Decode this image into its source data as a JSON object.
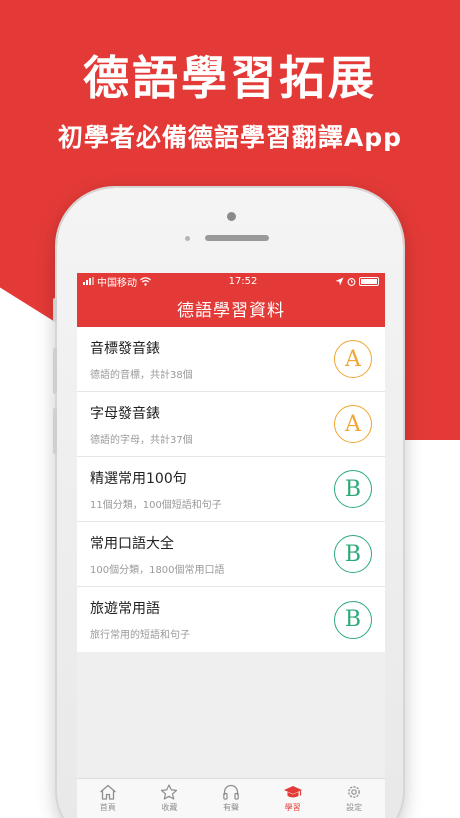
{
  "promo": {
    "title": "德語學習拓展",
    "subtitle": "初學者必備德語學習翻譯App"
  },
  "status_bar": {
    "carrier": "中国移动",
    "time": "17:52"
  },
  "nav": {
    "title": "德語學習資料"
  },
  "list": [
    {
      "title": "音標發音錶",
      "subtitle": "德語的音標，共計38個",
      "level": "A"
    },
    {
      "title": "字母發音錶",
      "subtitle": "德語的字母，共計37個",
      "level": "A"
    },
    {
      "title": "精選常用100句",
      "subtitle": "11個分類，100個短語和句子",
      "level": "B"
    },
    {
      "title": "常用口語大全",
      "subtitle": "100個分類，1800個常用口語",
      "level": "B"
    },
    {
      "title": "旅遊常用語",
      "subtitle": "旅行常用的短語和句子",
      "level": "B"
    }
  ],
  "tabs": [
    {
      "label": "首頁",
      "icon": "home-icon",
      "active": false
    },
    {
      "label": "收藏",
      "icon": "star-icon",
      "active": false
    },
    {
      "label": "有聲",
      "icon": "headphones-icon",
      "active": false
    },
    {
      "label": "學習",
      "icon": "graduation-cap-icon",
      "active": true
    },
    {
      "label": "設定",
      "icon": "gear-icon",
      "active": false
    }
  ],
  "colors": {
    "brand_red": "#e43a37",
    "level_a": "#f0a534",
    "level_b": "#2eaa7a",
    "tab_inactive": "#8e8e8e"
  }
}
